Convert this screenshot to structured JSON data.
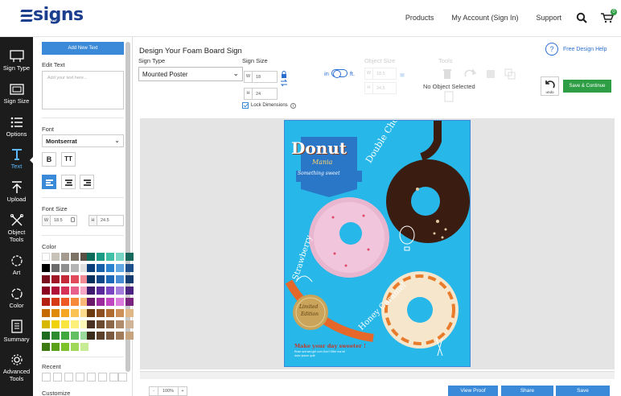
{
  "header": {
    "logo": "signs",
    "logo_sub": ".com",
    "nav": [
      "Products",
      "My Account (Sign In)",
      "Support"
    ],
    "cart_count": "0"
  },
  "rail": [
    {
      "label": "Sign Type",
      "icon": "sign-type-icon"
    },
    {
      "label": "Sign Size",
      "icon": "sign-size-icon"
    },
    {
      "label": "Options",
      "icon": "options-icon"
    },
    {
      "label": "Text",
      "icon": "text-icon",
      "active": true
    },
    {
      "label": "Upload",
      "icon": "upload-icon"
    },
    {
      "label": "Object Tools",
      "icon": "object-tools-icon"
    },
    {
      "label": "Art",
      "icon": "art-icon"
    },
    {
      "label": "Color",
      "icon": "color-icon"
    },
    {
      "label": "Summary",
      "icon": "summary-icon"
    },
    {
      "label": "Advanced Tools",
      "icon": "advanced-tools-icon"
    }
  ],
  "panel": {
    "add_button": "Add New Text",
    "edit_text_label": "Edit Text",
    "edit_text_placeholder": "Add your text here...",
    "font_label": "Font",
    "font_value": "Montserrat",
    "bold_label": "B",
    "caps_label": "TT",
    "font_size_label": "Font Size",
    "w_tag": "W",
    "w_value": "18.5",
    "h_tag": "H",
    "h_value": "24.5",
    "color_label": "Color",
    "recent_label": "Recent",
    "customize_label": "Customize"
  },
  "swatches": {
    "left": [
      [
        "#ffffff",
        "#c9c2b8",
        "#a49a8f",
        "#7d7266",
        "#5a4f44"
      ],
      [
        "#000000",
        "#6b6b6b",
        "#8f8f8f",
        "#b4b4b4",
        "#e0e0e0"
      ],
      [
        "#7a0f1e",
        "#a01828",
        "#c4293a",
        "#e04a5a",
        "#f08a94"
      ],
      [
        "#8b0020",
        "#b0123a",
        "#d63156",
        "#e8608c",
        "#f5a6c4"
      ],
      [
        "#b32014",
        "#d63b16",
        "#ef5a24",
        "#f78a3a",
        "#fbb878"
      ],
      [
        "#c46a00",
        "#e08a0a",
        "#f5a623",
        "#f9c252",
        "#fcdc8c"
      ],
      [
        "#d6b800",
        "#f0d20a",
        "#f9e540",
        "#fcf07a",
        "#fdf7b8"
      ],
      [
        "#1f6b1f",
        "#2e8b2e",
        "#3fa83f",
        "#62c062",
        "#9bd89b"
      ],
      [
        "#3e7a12",
        "#5aa018",
        "#7cc22a",
        "#a0d85a",
        "#c8eb96"
      ]
    ],
    "right": [
      [
        "#0b6b5a",
        "#1a9c84",
        "#3fbfa6",
        "#7ad6c4",
        "#17695c"
      ],
      [
        "#0a3d7a",
        "#145fa8",
        "#2a83d0",
        "#62a8e4",
        "#1c4f8c"
      ],
      [
        "#08305c",
        "#0f4788",
        "#1e68b8",
        "#4a8fd6",
        "#143c70"
      ],
      [
        "#3d1a6b",
        "#5a2a9c",
        "#7c46c2",
        "#a47cdc",
        "#4a2480"
      ],
      [
        "#6b1a6b",
        "#9c2a9c",
        "#c246c2",
        "#dc7cdc",
        "#7a2480"
      ],
      [
        "#6b3a10",
        "#8c5020",
        "#b06c30",
        "#cc9058",
        "#e0b888"
      ],
      [
        "#4a3020",
        "#6b4a30",
        "#8c6848",
        "#b08c6c",
        "#d0b498"
      ],
      [
        "#3a2a1a",
        "#5a402a",
        "#7a5a3e",
        "#a07c5a",
        "#c6a47e"
      ]
    ]
  },
  "main": {
    "title": "Design Your Foam Board Sign",
    "sign_type_label": "Sign Type",
    "sign_type_value": "Mounted Poster",
    "sign_size_label": "Sign Size",
    "w_tag": "W",
    "w_value": "18",
    "h_tag": "H",
    "h_value": "24",
    "lock_dims": "Lock Dimensions",
    "unit_in": "in",
    "unit_ft": "ft.",
    "object_size_label": "Object Size",
    "obj_w": "18.5",
    "obj_h": "24.5",
    "tools_label": "Tools",
    "no_object": "No Object Selected",
    "help": "Free Design Help",
    "undo": "undo",
    "save_continue": "Save & Continue",
    "zoom_minus": "-",
    "zoom_value": "100%",
    "zoom_plus": "+",
    "view_proof": "View Proof",
    "share": "Share",
    "save": "Save"
  },
  "poster": {
    "title": "Donut",
    "script": "Mania",
    "ribbon": "Something sweet",
    "chocolate": "Double Chocolate",
    "strawberry": "Strawberry",
    "caramel": "Honey Caramel",
    "badge_top": "Limited",
    "badge_bottom": "Edition",
    "tagline": "Make your day sweeter !",
    "small1": "Rose sed sed girl com Don't Offer ma sit",
    "small2": "dolor ipsum qulit"
  },
  "colors": {
    "brand": "#1b3e8f",
    "accent": "#3a8ad9",
    "success": "#2e9e44",
    "rail_bg": "#1c1c1c",
    "poster_bg": "#27b7e8"
  }
}
